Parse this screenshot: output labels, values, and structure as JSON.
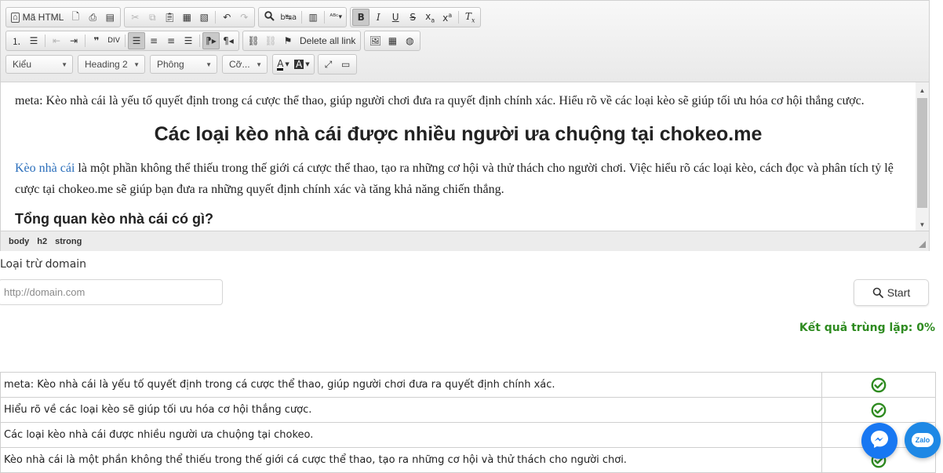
{
  "toolbar": {
    "row1": [
      {
        "name": "source-button",
        "label": "Mã HTML",
        "icon": "source-icon"
      },
      {
        "name": "preview-button",
        "label": "",
        "icon": "preview-icon"
      },
      {
        "name": "print-button",
        "label": "",
        "icon": "print-icon"
      },
      {
        "name": "templates-button",
        "label": "",
        "icon": "templates-icon"
      }
    ],
    "delete_all_link_label": "Delete all link"
  },
  "combos": {
    "style": "Kiểu",
    "format": "Heading 2",
    "font": "Phông",
    "size": "Cỡ..."
  },
  "content": {
    "meta_line": "meta: Kèo nhà cái là yếu tố quyết định trong cá cược thể thao, giúp người chơi đưa ra quyết định chính xác. Hiểu rõ về các loại kèo sẽ giúp tối ưu hóa cơ hội thắng cược.",
    "heading1": "Các loại kèo nhà cái được nhiều người ưa chuộng tại chokeo.me",
    "para_link": "Kèo nhà cái",
    "para_rest": " là một phần không thể thiếu trong thế giới cá cược thể thao, tạo ra những cơ hội và thử thách cho người chơi. Việc hiểu rõ các loại kèo, cách đọc và phân tích tỷ lệ cược tại chokeo.me sẽ giúp bạn đưa ra những quyết định chính xác và tăng khả năng chiến thắng.",
    "heading2": "Tổng quan kèo nhà cái có gì?"
  },
  "pathbar": [
    "body",
    "h2",
    "strong"
  ],
  "form": {
    "exclude_label": "Loại trừ domain",
    "domain_placeholder": "http://domain.com",
    "domain_value": "",
    "start_label": "Start",
    "result_text": "Kết quả trùng lặp: 0%"
  },
  "results": [
    {
      "text": "meta: Kèo nhà cái là yếu tố quyết định trong cá cược thể thao, giúp người chơi đưa ra quyết định chính xác.",
      "status": "ok"
    },
    {
      "text": "Hiểu rõ về các loại kèo sẽ giúp tối ưu hóa cơ hội thắng cược.",
      "status": "ok"
    },
    {
      "text": "Các loại kèo nhà cái được nhiều người ưa chuộng tại chokeo.",
      "status": "ok"
    },
    {
      "text": "Kèo nhà cái là một phần không thể thiếu trong thế giới cá cược thể thao, tạo ra những cơ hội và thử thách cho người chơi.",
      "status": "ok"
    }
  ],
  "floating": {
    "zalo_label": "Zalo"
  },
  "colors": {
    "success": "#2e8b20",
    "link": "#2a6ebb",
    "messenger": "#1877f2",
    "zalo": "#1e88e5"
  }
}
